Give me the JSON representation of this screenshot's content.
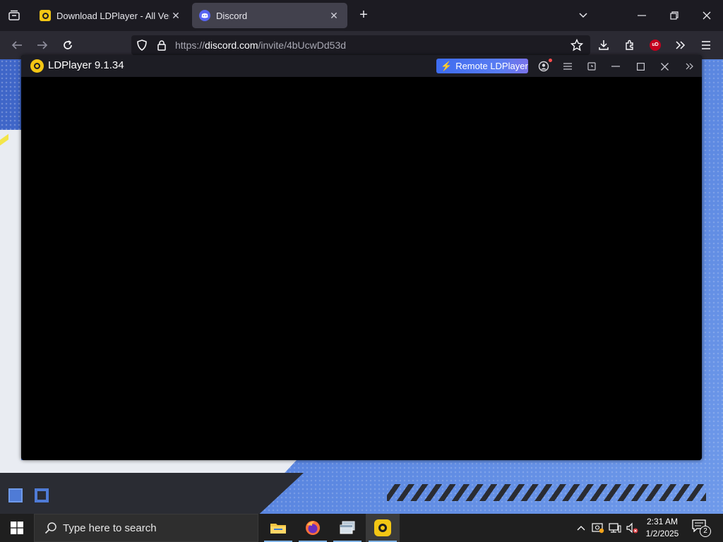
{
  "browser": {
    "tabs": [
      {
        "title": "Download LDPlayer - All Versions",
        "active": false,
        "icon": "ldplayer-favicon"
      },
      {
        "title": "Discord",
        "active": true,
        "icon": "discord-favicon"
      }
    ],
    "url": {
      "scheme": "https://",
      "host": "discord.com",
      "path": "/invite/4bUcwDd53d"
    }
  },
  "ldplayer": {
    "title": "LDPlayer 9.1.34",
    "remote_button": "Remote LDPlayer"
  },
  "taskbar": {
    "search_placeholder": "Type here to search",
    "time": "2:31 AM",
    "date": "1/2/2025",
    "notification_count": "2"
  },
  "colors": {
    "accent": "#5a7df2",
    "ld_yellow": "#f3c614",
    "discord_blurple": "#5865f2",
    "page_blue": "#4f7bd6"
  }
}
